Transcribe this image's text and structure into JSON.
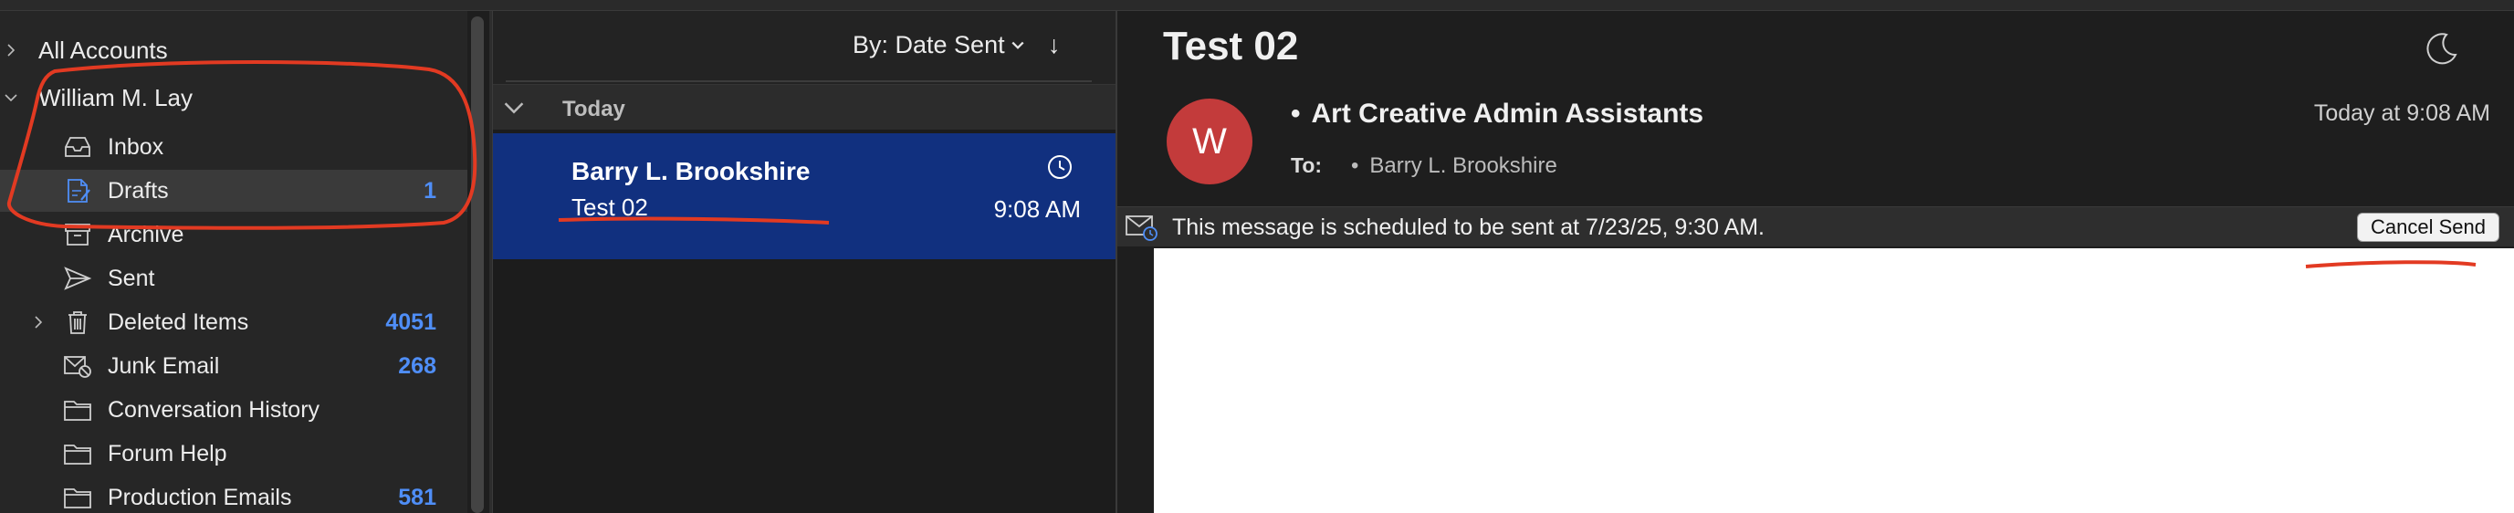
{
  "sidebar": {
    "all_accounts": "All Accounts",
    "account": "William M. Lay",
    "folders": [
      {
        "label": "Inbox",
        "count": ""
      },
      {
        "label": "Drafts",
        "count": "1"
      },
      {
        "label": "Archive",
        "count": ""
      },
      {
        "label": "Sent",
        "count": ""
      },
      {
        "label": "Deleted Items",
        "count": "4051"
      },
      {
        "label": "Junk Email",
        "count": "268"
      },
      {
        "label": "Conversation History",
        "count": ""
      },
      {
        "label": "Forum Help",
        "count": ""
      },
      {
        "label": "Production Emails",
        "count": "581"
      }
    ]
  },
  "list": {
    "sort_label": "By: Date Sent",
    "sort_direction": "↓",
    "group_label": "Today",
    "message": {
      "from": "Barry L. Brookshire",
      "subject": "Test 02",
      "time": "9:08 AM"
    }
  },
  "reader": {
    "subject": "Test 02",
    "avatar_initial": "W",
    "from": "Art Creative Admin Assistants",
    "to_label": "To:",
    "to": "Barry L. Brookshire",
    "date": "Today at 9:08 AM",
    "banner_text": "This message is scheduled to be sent at 7/23/25, 9:30 AM.",
    "cancel_label": "Cancel Send"
  },
  "colors": {
    "accent": "#4f8ef7",
    "selected_message": "#11307f",
    "avatar": "#c33b3b",
    "annotation": "#e23a22"
  }
}
